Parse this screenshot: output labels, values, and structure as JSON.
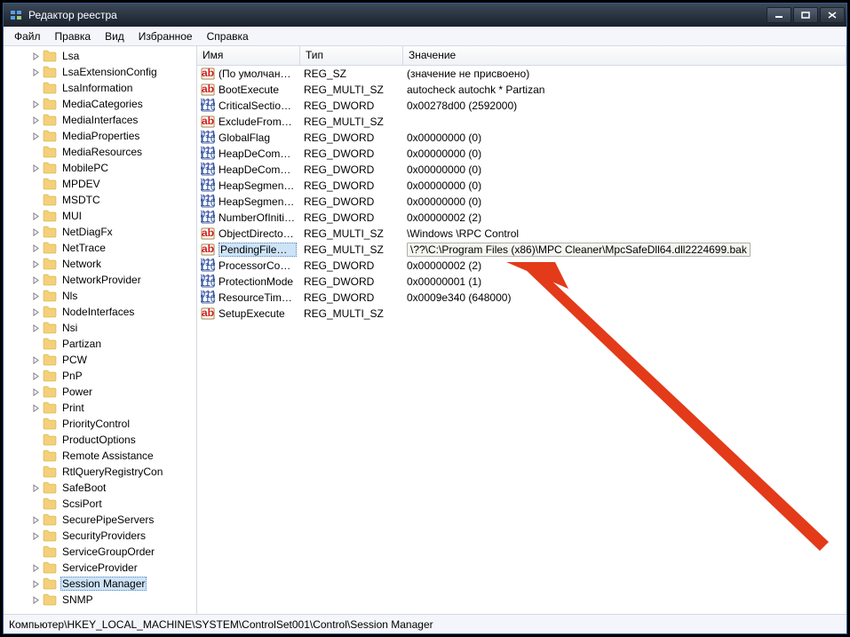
{
  "window": {
    "title": "Редактор реестра"
  },
  "menu": {
    "file": "Файл",
    "edit": "Правка",
    "view": "Вид",
    "favorites": "Избранное",
    "help": "Справка"
  },
  "tree": [
    {
      "label": "Lsa",
      "exp": "right"
    },
    {
      "label": "LsaExtensionConfig",
      "exp": "right"
    },
    {
      "label": "LsaInformation",
      "exp": "none"
    },
    {
      "label": "MediaCategories",
      "exp": "right"
    },
    {
      "label": "MediaInterfaces",
      "exp": "right"
    },
    {
      "label": "MediaProperties",
      "exp": "right"
    },
    {
      "label": "MediaResources",
      "exp": "none"
    },
    {
      "label": "MobilePC",
      "exp": "right"
    },
    {
      "label": "MPDEV",
      "exp": "none"
    },
    {
      "label": "MSDTC",
      "exp": "none"
    },
    {
      "label": "MUI",
      "exp": "right"
    },
    {
      "label": "NetDiagFx",
      "exp": "right"
    },
    {
      "label": "NetTrace",
      "exp": "right"
    },
    {
      "label": "Network",
      "exp": "right"
    },
    {
      "label": "NetworkProvider",
      "exp": "right"
    },
    {
      "label": "Nls",
      "exp": "right"
    },
    {
      "label": "NodeInterfaces",
      "exp": "right"
    },
    {
      "label": "Nsi",
      "exp": "right"
    },
    {
      "label": "Partizan",
      "exp": "none"
    },
    {
      "label": "PCW",
      "exp": "right"
    },
    {
      "label": "PnP",
      "exp": "right"
    },
    {
      "label": "Power",
      "exp": "right"
    },
    {
      "label": "Print",
      "exp": "right"
    },
    {
      "label": "PriorityControl",
      "exp": "none"
    },
    {
      "label": "ProductOptions",
      "exp": "none"
    },
    {
      "label": "Remote Assistance",
      "exp": "none"
    },
    {
      "label": "RtlQueryRegistryCon",
      "exp": "none"
    },
    {
      "label": "SafeBoot",
      "exp": "right"
    },
    {
      "label": "ScsiPort",
      "exp": "none"
    },
    {
      "label": "SecurePipeServers",
      "exp": "right"
    },
    {
      "label": "SecurityProviders",
      "exp": "right"
    },
    {
      "label": "ServiceGroupOrder",
      "exp": "none"
    },
    {
      "label": "ServiceProvider",
      "exp": "right"
    },
    {
      "label": "Session Manager",
      "exp": "right",
      "selected": true
    },
    {
      "label": "SNMP",
      "exp": "right"
    }
  ],
  "columns": {
    "name": "Имя",
    "type": "Тип",
    "value": "Значение"
  },
  "values": [
    {
      "icon": "ab",
      "name": "(По умолчанию)",
      "type": "REG_SZ",
      "value": "(значение не присвоено)"
    },
    {
      "icon": "ab",
      "name": "BootExecute",
      "type": "REG_MULTI_SZ",
      "value": "autocheck autochk * Partizan"
    },
    {
      "icon": "bin",
      "name": "CriticalSectionTi...",
      "type": "REG_DWORD",
      "value": "0x00278d00 (2592000)"
    },
    {
      "icon": "ab",
      "name": "ExcludeFromKn...",
      "type": "REG_MULTI_SZ",
      "value": ""
    },
    {
      "icon": "bin",
      "name": "GlobalFlag",
      "type": "REG_DWORD",
      "value": "0x00000000 (0)"
    },
    {
      "icon": "bin",
      "name": "HeapDeCommit...",
      "type": "REG_DWORD",
      "value": "0x00000000 (0)"
    },
    {
      "icon": "bin",
      "name": "HeapDeCommit...",
      "type": "REG_DWORD",
      "value": "0x00000000 (0)"
    },
    {
      "icon": "bin",
      "name": "HeapSegmentC...",
      "type": "REG_DWORD",
      "value": "0x00000000 (0)"
    },
    {
      "icon": "bin",
      "name": "HeapSegmentR...",
      "type": "REG_DWORD",
      "value": "0x00000000 (0)"
    },
    {
      "icon": "bin",
      "name": "NumberOfInitial...",
      "type": "REG_DWORD",
      "value": "0x00000002 (2)"
    },
    {
      "icon": "ab",
      "name": "ObjectDirectories",
      "type": "REG_MULTI_SZ",
      "value": "\\Windows \\RPC Control"
    },
    {
      "icon": "ab",
      "name": "PendingFileRen...",
      "type": "REG_MULTI_SZ",
      "value": "\\??\\C:\\Program Files (x86)\\MPC Cleaner\\MpcSafeDll64.dll2224699.bak",
      "selected": true
    },
    {
      "icon": "bin",
      "name": "ProcessorControl",
      "type": "REG_DWORD",
      "value": "0x00000002 (2)"
    },
    {
      "icon": "bin",
      "name": "ProtectionMode",
      "type": "REG_DWORD",
      "value": "0x00000001 (1)"
    },
    {
      "icon": "bin",
      "name": "ResourceTimeo...",
      "type": "REG_DWORD",
      "value": "0x0009e340 (648000)"
    },
    {
      "icon": "ab",
      "name": "SetupExecute",
      "type": "REG_MULTI_SZ",
      "value": ""
    }
  ],
  "status": "Компьютер\\HKEY_LOCAL_MACHINE\\SYSTEM\\ControlSet001\\Control\\Session Manager"
}
